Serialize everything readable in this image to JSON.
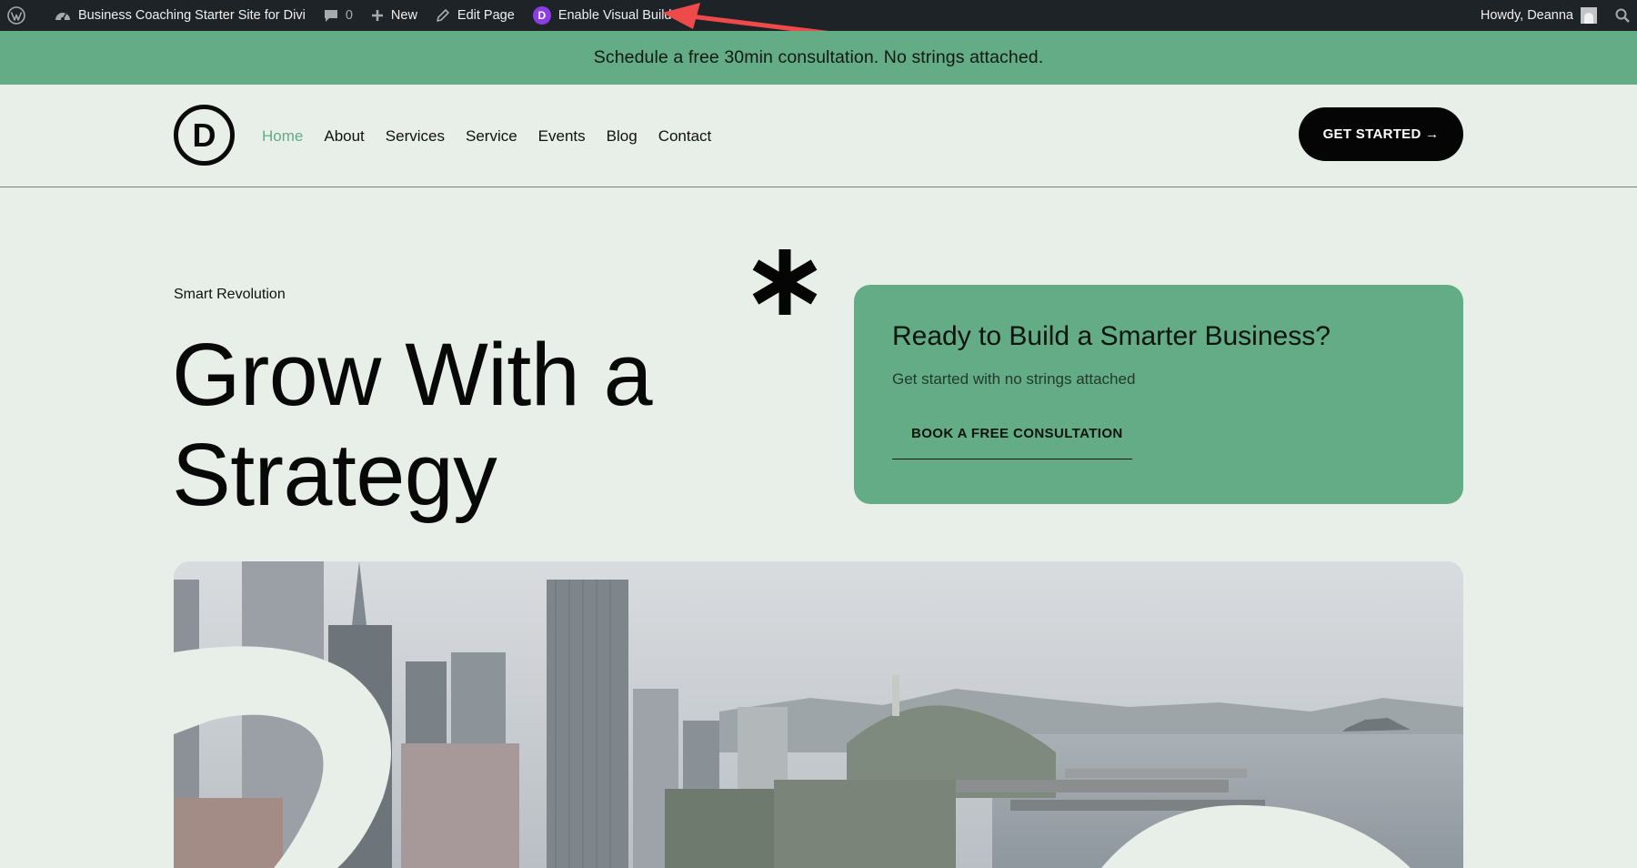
{
  "admin_bar": {
    "site_name": "Business Coaching Starter Site for Divi",
    "comments_count": "0",
    "new_label": "New",
    "edit_page_label": "Edit Page",
    "visual_builder_label": "Enable Visual Builder",
    "visual_builder_badge": "D",
    "greeting": "Howdy, Deanna",
    "icons": [
      "wordpress-logo-icon",
      "dashboard-icon",
      "comment-icon",
      "plus-icon",
      "pencil-icon",
      "divi-icon",
      "avatar",
      "search-icon"
    ]
  },
  "promo": {
    "text": "Schedule a free 30min consultation. No strings attached."
  },
  "header": {
    "logo_letter": "D",
    "nav": [
      {
        "label": "Home",
        "active": true
      },
      {
        "label": "About"
      },
      {
        "label": "Services"
      },
      {
        "label": "Service"
      },
      {
        "label": "Events"
      },
      {
        "label": "Blog"
      },
      {
        "label": "Contact"
      }
    ],
    "cta_label": "GET STARTED →"
  },
  "hero": {
    "eyebrow": "Smart Revolution",
    "title_line1": "Grow With a",
    "title_line2": "Strategy"
  },
  "card": {
    "title": "Ready to Build a Smarter Business?",
    "subtitle": "Get started with no strings attached",
    "link_label": "BOOK A FREE CONSULTATION"
  },
  "colors": {
    "accent_green": "#63ac86",
    "page_bg": "#e8efe8",
    "admin_bar_bg": "#1d2327",
    "divi_purple": "#8c3ee6",
    "annotation_red": "#ef4a4a"
  }
}
